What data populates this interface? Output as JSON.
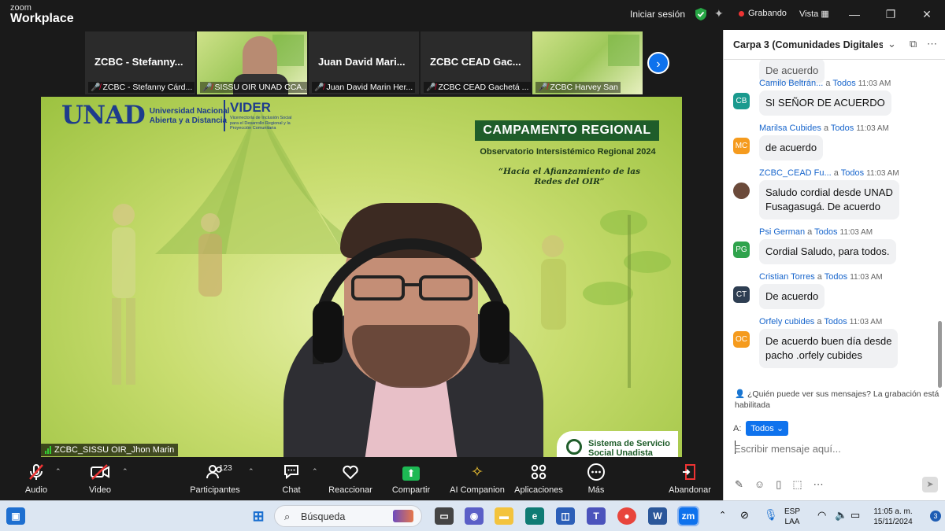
{
  "app": {
    "logo_top": "zoom",
    "logo_bottom": "Workplace",
    "sign_in": "Iniciar sesión",
    "recording": "Grabando",
    "view": "Vista"
  },
  "thumbnails": [
    {
      "big_name": "ZCBC - Stefanny...",
      "label": "ZCBC - Stefanny Cárd...",
      "video": false
    },
    {
      "big_name": "",
      "label": "SISSU OIR UNAD CCA...",
      "video": true
    },
    {
      "big_name": "Juan David Mari...",
      "label": "Juan David Marin Her...",
      "video": false
    },
    {
      "big_name": "ZCBC CEAD Gac...",
      "label": "ZCBC CEAD Gachetá ...",
      "video": false
    },
    {
      "big_name": "",
      "label": "ZCBC Harvey San",
      "video": true
    }
  ],
  "main_video": {
    "speaker_label": "ZCBC_SISSU OIR_Jhon Marin",
    "unad_logo": "UNAD",
    "unad_name_1": "Universidad Nacional",
    "unad_name_2": "Abierta y a Distancia",
    "vider": "VIDER",
    "vider_sub": "Vicerrectoría de Inclusión Social para el Desarrollo Regional y la Proyección Comunitaria",
    "campaign_title": "CAMPAMENTO REGIONAL",
    "observatory": "Observatorio Intersistémico Regional 2024",
    "quote": "“Hacia el Afianzamiento de las Redes del OIR”",
    "sss_line1": "Sistema de Servicio",
    "sss_line2": "Social Unadista"
  },
  "toolbar": {
    "audio": "Audio",
    "video": "Video",
    "participants": "Participantes",
    "participants_count": "123",
    "chat": "Chat",
    "react": "Reaccionar",
    "share": "Compartir",
    "ai": "AI Companion",
    "apps": "Aplicaciones",
    "more": "Más",
    "leave": "Abandonar"
  },
  "chat": {
    "title": "Carpa 3 (Comunidades Digitales ...",
    "partial_message": "De acuerdo",
    "messages": [
      {
        "name": "Camilo Beltrán...",
        "to": "a",
        "target": "Todos",
        "time": "11:03 AM",
        "initials": "CB",
        "color": "#1a9a8e",
        "text": "SI SEÑOR DE ACUERDO",
        "text2": ""
      },
      {
        "name": "Marilsa Cubides",
        "to": "a",
        "target": "Todos",
        "time": "11:03 AM",
        "initials": "MC",
        "color": "#f59b1e",
        "text": "de acuerdo",
        "text2": ""
      },
      {
        "name": "ZCBC_CEAD Fu...",
        "to": "a",
        "target": "Todos",
        "time": "11:03 AM",
        "initials": "",
        "color": "#6b4a3a",
        "text": "Saludo cordial desde UNAD",
        "text2": "Fusagasugá. De acuerdo"
      },
      {
        "name": "Psi German",
        "to": "a",
        "target": "Todos",
        "time": "11:03 AM",
        "initials": "PG",
        "color": "#2fa34c",
        "text": "Cordial Saludo, para todos.",
        "text2": ""
      },
      {
        "name": "Cristian Torres",
        "to": "a",
        "target": "Todos",
        "time": "11:03 AM",
        "initials": "CT",
        "color": "#2e3e52",
        "text": "De acuerdo",
        "text2": ""
      },
      {
        "name": "Orfely cubides",
        "to": "a",
        "target": "Todos",
        "time": "11:03 AM",
        "initials": "OC",
        "color": "#f59b1e",
        "text": "De acuerdo buen día desde",
        "text2": "pacho .orfely cubides"
      }
    ],
    "privacy_note": "¿Quién puede ver sus mensajes? La grabación está habilitada",
    "to_label": "A:",
    "to_value": "Todos",
    "input_placeholder": "Escribir mensaje aquí..."
  },
  "taskbar": {
    "search": "Búsqueda",
    "lang1": "ESP",
    "lang2": "LAA",
    "time": "11:05 a. m.",
    "date": "15/11/2024",
    "notifications": "3"
  }
}
